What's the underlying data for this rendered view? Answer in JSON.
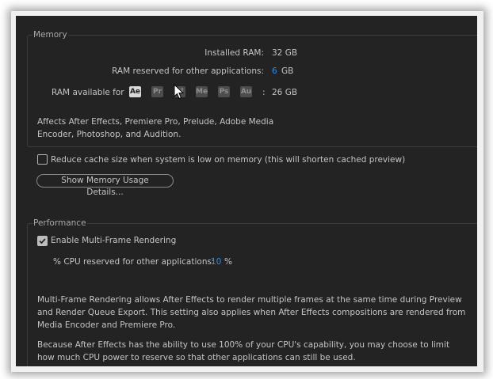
{
  "memory": {
    "section_title": "Memory",
    "installed_ram_label": "Installed RAM:",
    "installed_ram_value": "32 GB",
    "reserved_label": "RAM reserved for other applications:",
    "reserved_value": "6",
    "reserved_unit": "GB",
    "available_label": "RAM available for",
    "apps": [
      "Ae",
      "Pr",
      "Pl",
      "Me",
      "Ps",
      "Au"
    ],
    "available_separator": ":",
    "available_value": "26 GB",
    "description": "Affects After Effects, Premiere Pro, Prelude, Adobe Media Encoder, Photoshop, and Audition.",
    "reduce_cache_label": "Reduce cache size when system is low on memory (this will shorten cached preview)",
    "reduce_cache_checked": false,
    "details_button": "Show Memory Usage Details..."
  },
  "performance": {
    "section_title": "Performance",
    "mfr_label": "Enable Multi-Frame Rendering",
    "mfr_checked": true,
    "cpu_reserved_label": "% CPU reserved for other applications:",
    "cpu_reserved_value": "10",
    "cpu_reserved_unit": "%",
    "description_1": "Multi-Frame Rendering allows After Effects to render multiple frames at the same time during Preview and Render Queue Export. This setting also applies when After Effects compositions are rendered from Media Encoder and Premiere Pro.",
    "description_2": "Because After Effects has the ability to use 100% of your CPU's capability, you may choose to limit how much CPU power to reserve so that other applications can still be used."
  },
  "colors": {
    "background": "#232323",
    "text": "#c4c4c4",
    "accent": "#2f8be5"
  }
}
